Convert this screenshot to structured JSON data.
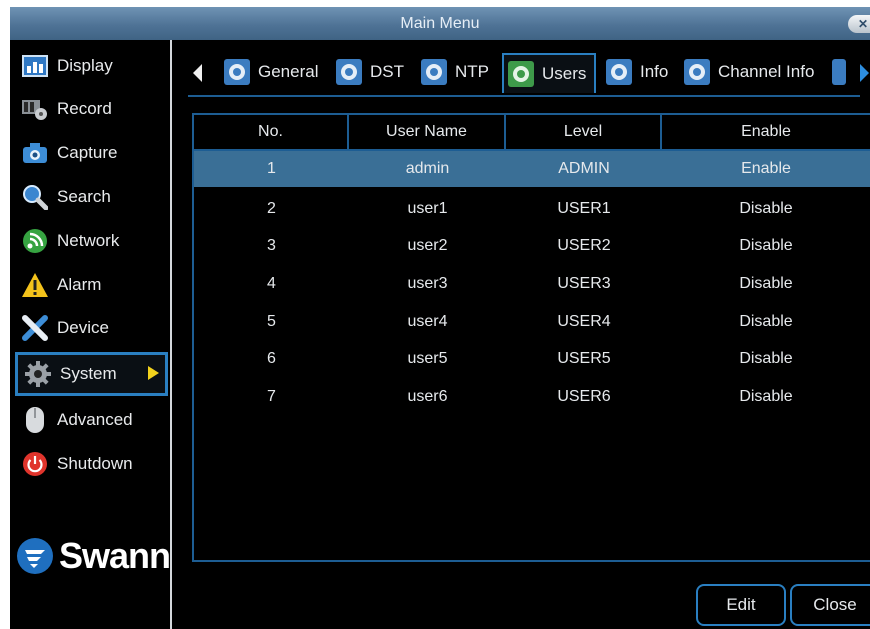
{
  "window": {
    "title": "Main Menu",
    "close_symbol": "✕"
  },
  "sidebar": {
    "items": [
      {
        "label": "Display",
        "icon": "display-icon"
      },
      {
        "label": "Record",
        "icon": "record-icon"
      },
      {
        "label": "Capture",
        "icon": "camera-icon"
      },
      {
        "label": "Search",
        "icon": "search-icon"
      },
      {
        "label": "Network",
        "icon": "network-icon"
      },
      {
        "label": "Alarm",
        "icon": "alarm-icon"
      },
      {
        "label": "Device",
        "icon": "device-icon"
      },
      {
        "label": "System",
        "icon": "gear-icon",
        "active": true
      },
      {
        "label": "Advanced",
        "icon": "mouse-icon"
      },
      {
        "label": "Shutdown",
        "icon": "power-icon"
      }
    ],
    "logo_text": "Swann"
  },
  "tabs": [
    {
      "label": "General",
      "icon": "settings-icon"
    },
    {
      "label": "DST",
      "icon": "settings-icon"
    },
    {
      "label": "NTP",
      "icon": "settings-icon"
    },
    {
      "label": "Users",
      "icon": "settings-icon",
      "active": true
    },
    {
      "label": "Info",
      "icon": "settings-icon"
    },
    {
      "label": "Channel Info",
      "icon": "settings-icon"
    }
  ],
  "table": {
    "headers": [
      "No.",
      "User Name",
      "Level",
      "Enable"
    ],
    "rows": [
      [
        "1",
        "admin",
        "ADMIN",
        "Enable"
      ],
      [
        "2",
        "user1",
        "USER1",
        "Disable"
      ],
      [
        "3",
        "user2",
        "USER2",
        "Disable"
      ],
      [
        "4",
        "user3",
        "USER3",
        "Disable"
      ],
      [
        "5",
        "user4",
        "USER4",
        "Disable"
      ],
      [
        "6",
        "user5",
        "USER5",
        "Disable"
      ],
      [
        "7",
        "user6",
        "USER6",
        "Disable"
      ]
    ],
    "selected_row": 0
  },
  "buttons": {
    "edit": "Edit",
    "close": "Close"
  },
  "colors": {
    "accent": "#2a7fc1",
    "selected_row": "#3a6f96",
    "title_bar": "#5a7fa3"
  }
}
